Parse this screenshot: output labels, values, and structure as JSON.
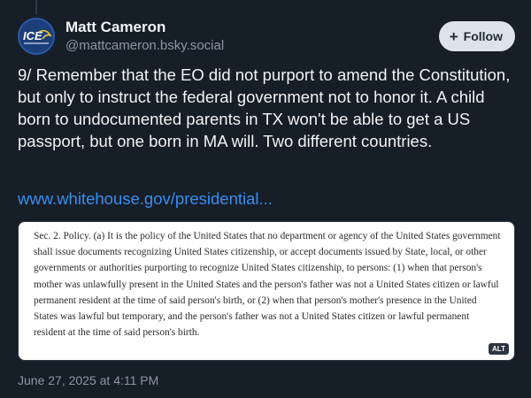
{
  "author": {
    "display_name": "Matt Cameron",
    "handle": "@mattcameron.bsky.social",
    "avatar_text": "ICE"
  },
  "follow_button": {
    "icon": "plus-icon",
    "label": "Follow"
  },
  "post": {
    "text": "9/ Remember that the EO did not purport to amend the Constitution, but only to instruct the federal government not to honor it. A child born to undocumented parents in TX won't be able to get a US passport, but one born in MA will. Two different countries.",
    "link_text": "www.whitehouse.gov/presidential..."
  },
  "image": {
    "text": "Sec. 2.  Policy.  (a)  It is the policy of the United States that no department or agency of the United States government shall issue documents recognizing United States citizenship, or accept documents issued by State, local, or other governments or authorities purporting to recognize United States citizenship, to persons:  (1) when that person's mother was unlawfully present in the United States and the person's father was not a United States citizen or lawful permanent resident at the time of said person's birth, or (2) when that person's mother's presence in the United States was lawful but temporary, and the person's father was not a United States citizen or lawful permanent resident at the time of said person's birth.",
    "alt_badge": "ALT"
  },
  "timestamp": "June 27, 2025 at 4:11 PM",
  "colors": {
    "background": "#161e27",
    "link": "#3b8ef0",
    "follow_bg": "#dde3ea"
  }
}
